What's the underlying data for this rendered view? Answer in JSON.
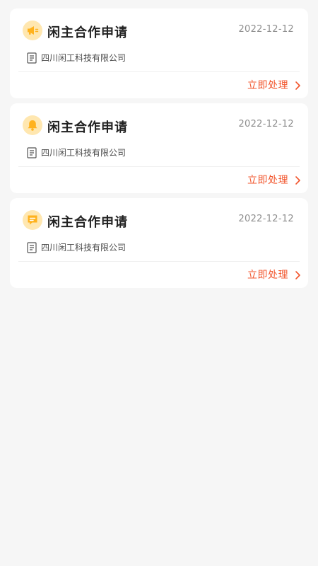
{
  "colors": {
    "page_background": "#f6f6f6",
    "card_background": "#ffffff",
    "icon_badge": "#ffe7b0",
    "icon_fill": "#ffb21d",
    "action_text": "#f2552c"
  },
  "cards": [
    {
      "icon": "megaphone-icon",
      "title": "闲主合作申请",
      "date": "2022-12-12",
      "company": "四川闲工科技有限公司",
      "action": "立即处理"
    },
    {
      "icon": "bell-icon",
      "title": "闲主合作申请",
      "date": "2022-12-12",
      "company": "四川闲工科技有限公司",
      "action": "立即处理"
    },
    {
      "icon": "message-icon",
      "title": "闲主合作申请",
      "date": "2022-12-12",
      "company": "四川闲工科技有限公司",
      "action": "立即处理"
    }
  ]
}
